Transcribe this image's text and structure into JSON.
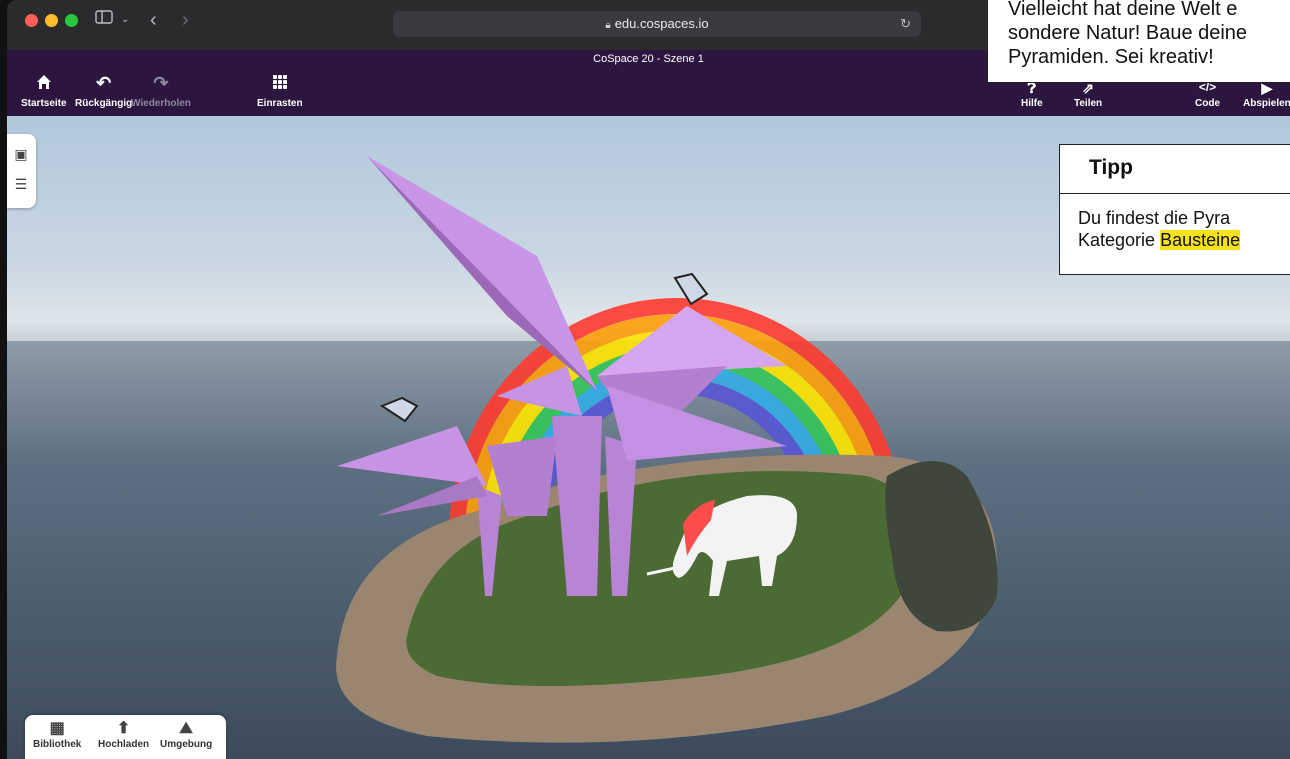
{
  "browser": {
    "url": "edu.cospaces.io",
    "icons": [
      "sidebar-toggle-icon",
      "chevron-down-icon",
      "back-icon",
      "forward-icon",
      "lock-icon",
      "reload-icon"
    ]
  },
  "app": {
    "scene_title": "CoSpace 20 - Szene 1",
    "accent": "#2c163f",
    "toolbar_left": {
      "home": "Startseite",
      "undo": "Rückgängig",
      "redo": "Wiederholen",
      "snap": "Einrasten"
    },
    "toolbar_right": {
      "help": "Hilfe",
      "share": "Teilen",
      "code": "Code",
      "play": "Abspielen"
    },
    "bottom_bar": {
      "library": "Bibliothek",
      "upload": "Hochladen",
      "environment": "Umgebung"
    }
  },
  "task": {
    "line1": "Vielleicht hat deine Welt e",
    "line2": "sondere Natur! Baue deine",
    "line3": "Pyramiden. Sei kreativ!"
  },
  "tip": {
    "title": "Tipp",
    "line1": "Du findest die Pyra",
    "line2_prefix": "Kategorie ",
    "line2_highlight": "Bausteine",
    "highlight_color": "#f5e11d"
  }
}
